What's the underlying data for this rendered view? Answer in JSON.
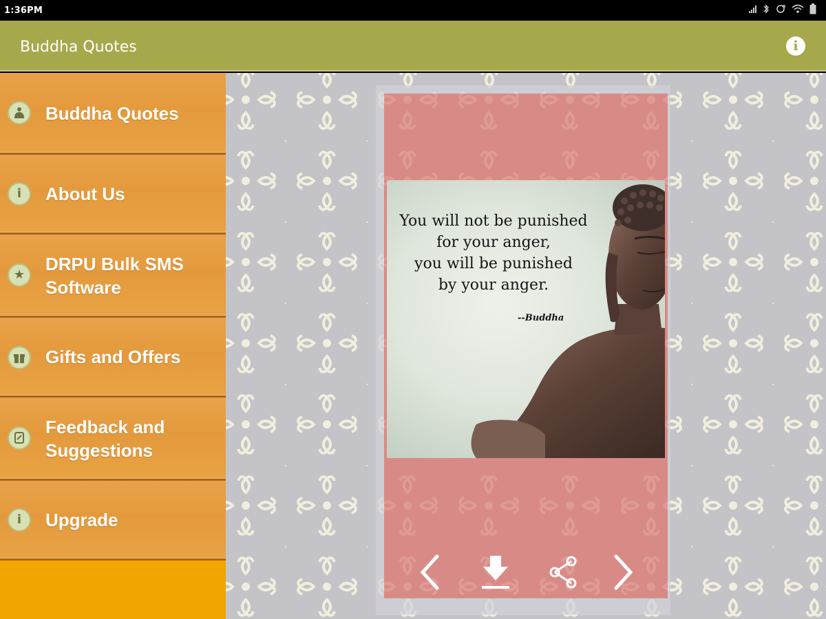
{
  "status_bar": {
    "time": "1:36PM",
    "icons": [
      "signal-icon",
      "bluetooth-icon",
      "sync-icon",
      "wifi-icon",
      "battery-icon"
    ]
  },
  "action_bar": {
    "title": "Buddha Quotes",
    "info_icon": "info-icon"
  },
  "colors": {
    "action_bar": "#a6a84c",
    "sidebar": "#e6a04a",
    "sidebar_bottom": "#f0a500",
    "card": "#d88b86",
    "content_bg": "#c3c3c8"
  },
  "sidebar": {
    "items": [
      {
        "label": "Buddha Quotes",
        "icon": "buddha-icon"
      },
      {
        "label": "About Us",
        "icon": "info-icon"
      },
      {
        "label": "DRPU Bulk SMS Software",
        "icon": "star-icon"
      },
      {
        "label": "Gifts and Offers",
        "icon": "gift-icon"
      },
      {
        "label": "Feedback and Suggestions",
        "icon": "feedback-icon"
      },
      {
        "label": "Upgrade",
        "icon": "info-icon"
      }
    ]
  },
  "quote": {
    "text_lines": [
      "You will not be punished",
      "for your anger,",
      "you will be punished",
      "by your anger."
    ],
    "author": "--Buddha"
  },
  "controls": {
    "icons": [
      "previous-icon",
      "download-icon",
      "share-icon",
      "next-icon"
    ]
  }
}
